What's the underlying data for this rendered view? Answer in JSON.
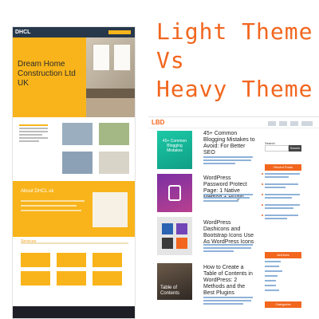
{
  "headline": {
    "line1": "Light Theme",
    "line2": "Vs",
    "line3": "Heavy Theme"
  },
  "heavy_site": {
    "logo": "DHCL",
    "hero_title": "Dream Home Construction Ltd UK",
    "about_heading": "About DHCL uk",
    "services_heading": "Services"
  },
  "light_site": {
    "logo": "LBD",
    "search_label": "Search",
    "search_button": "Search",
    "posts": [
      {
        "title": "45+ Common Blogging Mistakes to Avoid: For Better SEO",
        "thumb_text": "45+ Common Blogging Mistakes"
      },
      {
        "title": "WordPress Password Protect Page: 1 Native Method + Plugin",
        "thumb_text": ""
      },
      {
        "title": "WordPress Dashicons and Bootstrap Icons Use As WordPress Icons",
        "thumb_text": ""
      },
      {
        "title": "How to Create a Table of Contents in WordPress: 2 Methods and the Best Plugins",
        "thumb_text": "Table of Contents"
      }
    ],
    "sidebar": {
      "recent_posts": "Recent Posts",
      "archives": "Archives",
      "categories": "Categories"
    }
  },
  "colors": {
    "accent_orange": "#f2661e",
    "construction_yellow": "#f8b41a",
    "navy": "#27384b"
  }
}
